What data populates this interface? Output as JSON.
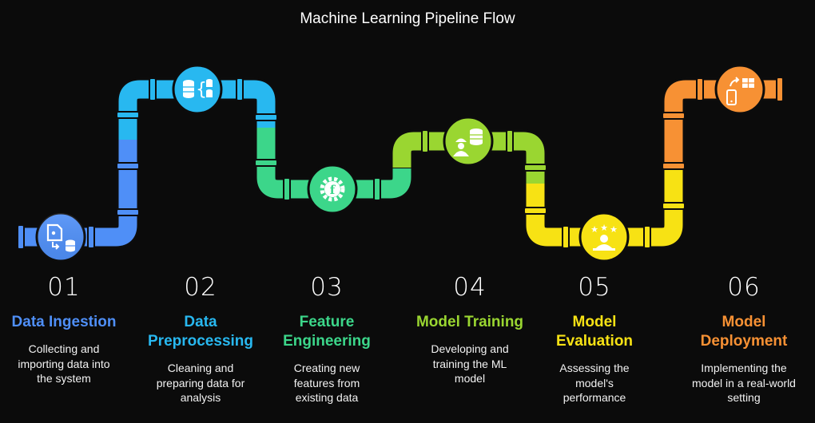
{
  "title": "Machine Learning Pipeline Flow",
  "stages": [
    {
      "number": "01",
      "name": "Data Ingestion",
      "description": "Collecting and\nimporting data into\nthe system",
      "color": "#4f8ff7",
      "icon": "data-import-icon"
    },
    {
      "number": "02",
      "name": "Data\nPreprocessing",
      "description": "Cleaning and\npreparing data for\nanalysis",
      "color": "#28b8f0",
      "icon": "data-transform-icon"
    },
    {
      "number": "03",
      "name": "Feature\nEngineering",
      "description": "Creating new\nfeatures from\nexisting data",
      "color": "#3cd68a",
      "icon": "function-gear-icon"
    },
    {
      "number": "04",
      "name": "Model Training",
      "description": "Developing and\ntraining the ML\nmodel",
      "color": "#9ad631",
      "icon": "worker-database-icon"
    },
    {
      "number": "05",
      "name": "Model\nEvaluation",
      "description": "Assessing the\nmodel's\nperformance",
      "color": "#f7e214",
      "icon": "rating-stars-icon"
    },
    {
      "number": "06",
      "name": "Model\nDeployment",
      "description": "Implementing the\nmodel in a real-world\nsetting",
      "color": "#f79134",
      "icon": "mobile-deploy-icon"
    }
  ]
}
